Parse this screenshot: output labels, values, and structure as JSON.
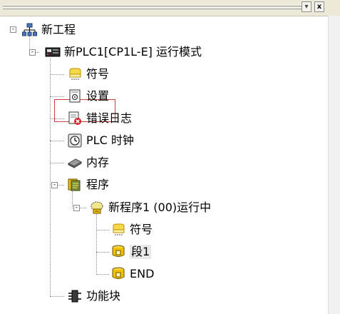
{
  "window": {
    "pin_glyph": "▾",
    "close_glyph": "x"
  },
  "tree": {
    "root_label": "新工程",
    "plc_label": "新PLC1[CP1L-E] 运行模式",
    "items": {
      "symbols": "符号",
      "settings": "设置",
      "error_log": "错误日志",
      "plc_clock": "PLC 时钟",
      "memory": "内存",
      "programs": "程序",
      "program1": "新程序1 (00)运行中",
      "program_symbols": "符号",
      "section1": "段1",
      "end": "END",
      "function_blocks": "功能块"
    },
    "expanders": {
      "collapse": "-"
    }
  },
  "colors": {
    "selection_border": "#c9403f",
    "highlight_bg": "#e8e8e8",
    "error_red": "#d8202a",
    "folder_yellow": "#f0c000"
  }
}
